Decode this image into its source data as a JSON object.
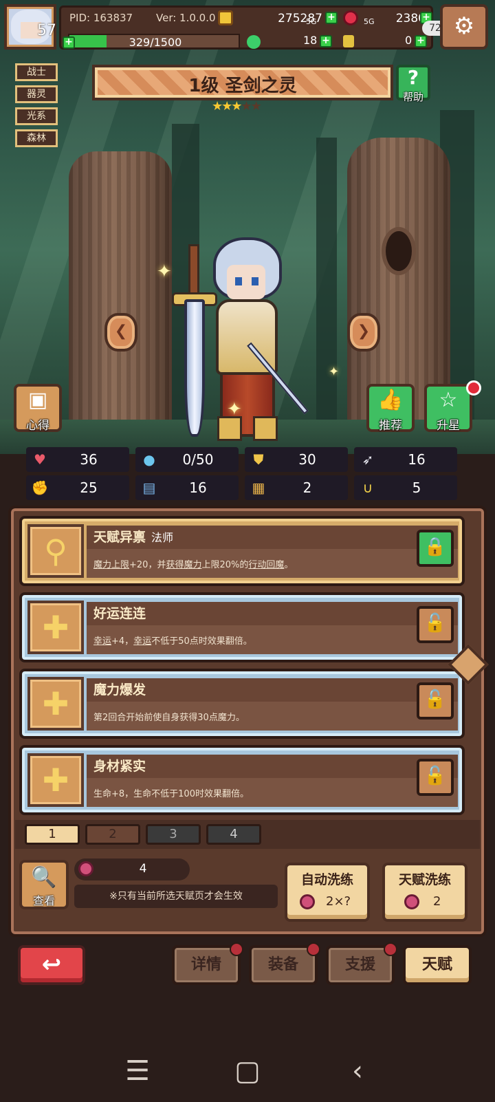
{
  "status": {
    "pid": "PID: 163837",
    "version": "Ver: 1.0.0.0",
    "gold": "275287",
    "gems": "2380",
    "clock": "57",
    "exp": "329/1500",
    "exp_ratio": 0.219,
    "energy_a": "18",
    "energy_b": "0",
    "battery": "72",
    "network_a": "5G",
    "network_b": "5G"
  },
  "tags": [
    "战士",
    "器灵",
    "光系",
    "森林"
  ],
  "hero": {
    "title": "1级  圣剑之灵",
    "stars_filled": 3,
    "stars_total": 5,
    "help_label": "帮助"
  },
  "side_buttons": {
    "insight": "心得",
    "recommend": "推荐",
    "star_up": "升星"
  },
  "stats": [
    {
      "icon": "heart-icon",
      "value": "36",
      "color": "#ea5a6a"
    },
    {
      "icon": "mana-drop-icon",
      "value": "0/50",
      "color": "#6cc6ee"
    },
    {
      "icon": "shield-icon",
      "value": "30",
      "color": "#f0c54a"
    },
    {
      "icon": "wing-icon",
      "value": "16",
      "color": "#e8e8f0"
    },
    {
      "icon": "fist-icon",
      "value": "25",
      "color": "#e97a6a"
    },
    {
      "icon": "book-icon",
      "value": "16",
      "color": "#7ab6ea"
    },
    {
      "icon": "scroll-icon",
      "value": "2",
      "color": "#e9b34a"
    },
    {
      "icon": "horseshoe-icon",
      "value": "5",
      "color": "#f0d04a"
    }
  ],
  "talents": [
    {
      "name": "天赋异禀",
      "sub": "法师",
      "desc_parts": [
        "魔力上限",
        "+20，并",
        "获得魔力",
        "上限20%的",
        "行动回魔",
        "。"
      ],
      "icon": "wand-icon",
      "locked": false,
      "style": "gold"
    },
    {
      "name": "好运连连",
      "sub": "",
      "desc_parts": [
        "幸运",
        "+4，",
        "幸运",
        "不低于50点时效果翻倍。"
      ],
      "icon": "cross-icon",
      "locked": true,
      "style": "blue"
    },
    {
      "name": "魔力爆发",
      "sub": "",
      "desc_parts": [
        "第2回合开始前使自身获得30点魔力。"
      ],
      "icon": "cross-icon",
      "locked": true,
      "style": "blue"
    },
    {
      "name": "身材紧实",
      "sub": "",
      "desc_parts": [
        "生命+8，生命不低于100时效果翻倍。"
      ],
      "icon": "cross-icon",
      "locked": true,
      "style": "blue"
    }
  ],
  "pages": [
    "1",
    "2",
    "3",
    "4"
  ],
  "bottom": {
    "view_label": "查看",
    "potion_count": "4",
    "note": "※只有当前所选天赋页才会生效",
    "auto_reroll": {
      "label": "自动洗练",
      "cost": "2×?"
    },
    "talent_reroll": {
      "label": "天赋洗练",
      "cost": "2"
    }
  },
  "nav": {
    "details": "详情",
    "equipment": "装备",
    "support": "支援",
    "talent": "天赋"
  }
}
